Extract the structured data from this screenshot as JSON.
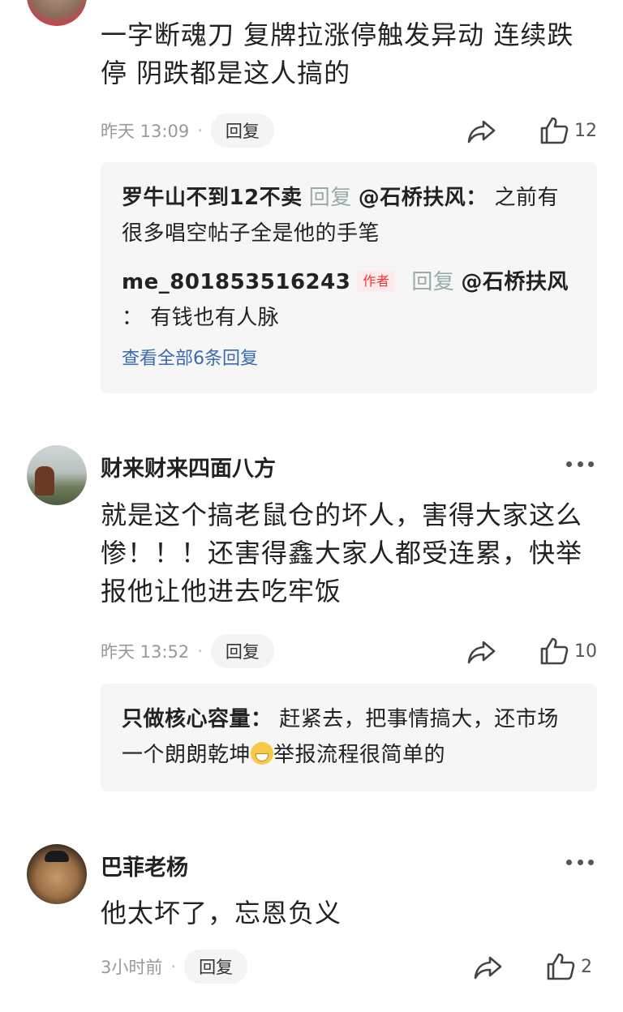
{
  "comments": [
    {
      "content": "一字断魂刀 复牌拉涨停触发异动 连续跌停 阴跌都是这人搞的",
      "time": "昨天 13:09",
      "reply_label": "回复",
      "likes": "12",
      "replies": [
        {
          "name": "罗牛山不到12不卖",
          "reply_word": "回复",
          "at": "@石桥扶风：",
          "text": "之前有很多唱空帖子全是他的手笔"
        },
        {
          "name": "me_801853516243",
          "author_tag": "作者",
          "reply_word": "回复",
          "at": "@石桥扶风",
          "text": "： 有钱也有人脉"
        }
      ],
      "view_all": "查看全部6条回复"
    },
    {
      "username": "财来财来四面八方",
      "content": "就是这个搞老鼠仓的坏人，害得大家这么惨！！！还害得鑫大家人都受连累，快举报他让他进去吃牢饭",
      "time": "昨天 13:52",
      "reply_label": "回复",
      "likes": "10",
      "replies": [
        {
          "name": "只做核心容量：",
          "text_a": "赶紧去，把事情搞大，还市场一个朗朗乾坤",
          "emoji": "grinning-face",
          "text_b": "举报流程很简单的"
        }
      ]
    },
    {
      "username": "巴菲老杨",
      "content": "他太坏了，忘恩负义",
      "time": "3小时前",
      "reply_label": "回复",
      "likes": "2"
    }
  ],
  "meta_separator": "·"
}
